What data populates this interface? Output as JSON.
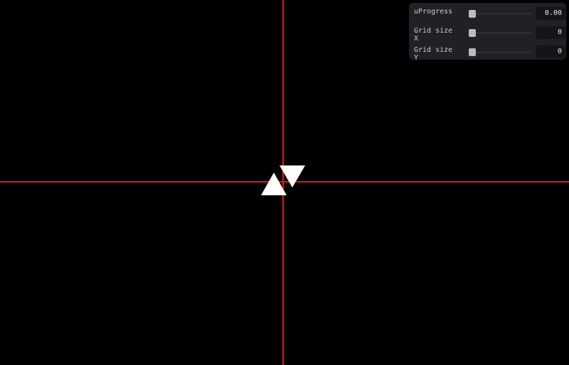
{
  "colors": {
    "background": "#000000",
    "axis": "#e8141b",
    "shape": "#ffffff",
    "panel": "#1f2126"
  },
  "controls": [
    {
      "label": "uProgress",
      "value": "0.00",
      "level": 0
    },
    {
      "label": "Grid size X",
      "value": "0",
      "level": 0
    },
    {
      "label": "Grid size Y",
      "value": "0",
      "level": 0
    }
  ],
  "scene": {
    "shapes": [
      "triangle-up",
      "triangle-down"
    ]
  }
}
